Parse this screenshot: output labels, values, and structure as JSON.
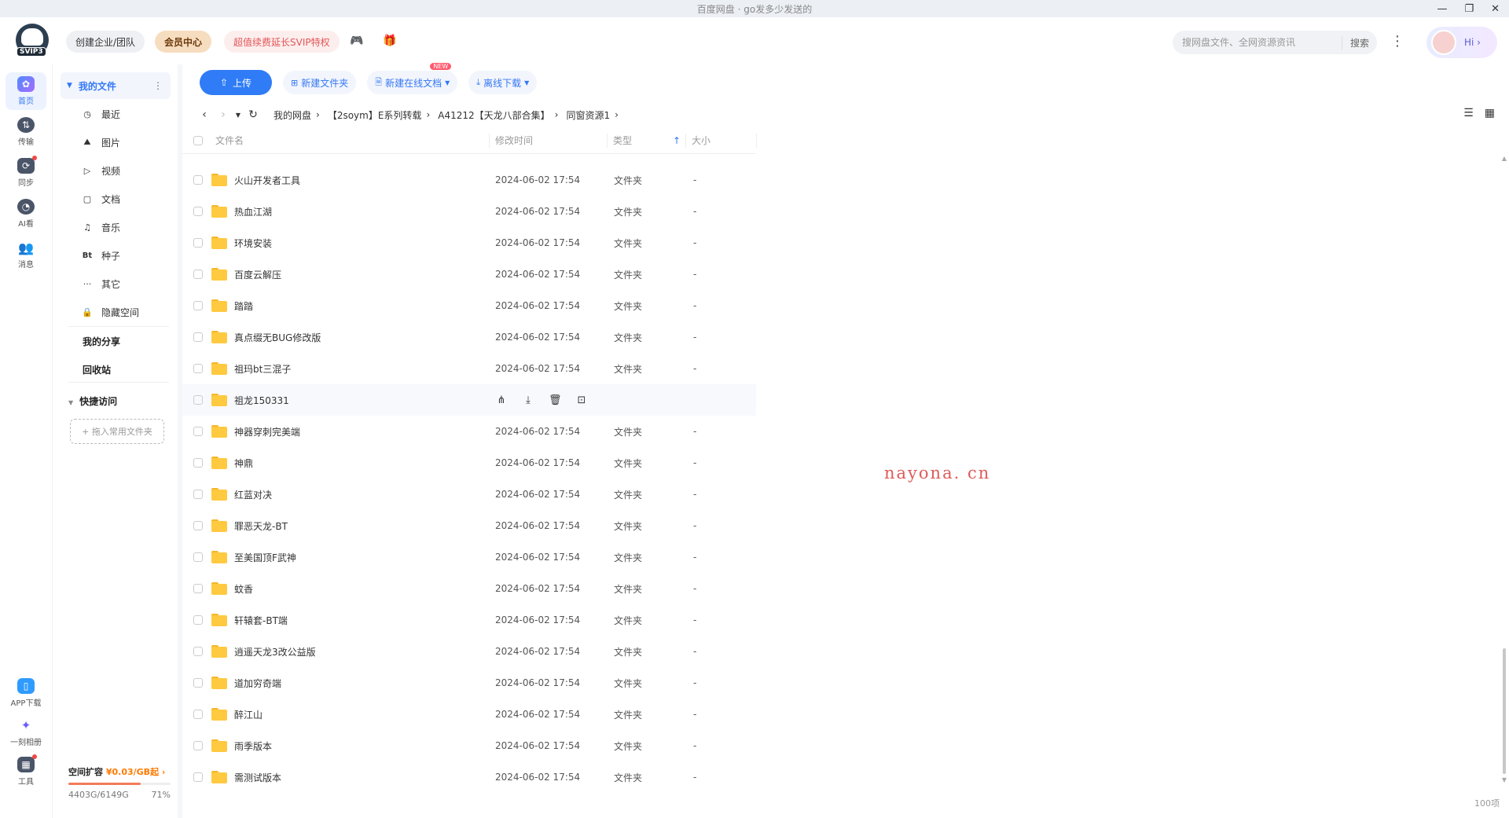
{
  "window": {
    "title": "百度网盘 · go发多少发送的",
    "controls": [
      "—",
      "❐",
      "✕"
    ]
  },
  "header": {
    "logo_badge": "SVIP3",
    "team_label": "创建企业/团队",
    "vip_label": "会员中心",
    "svip_label": "超值续费延长SVIP特权",
    "search_placeholder": "搜网盘文件、全网资源资讯",
    "search_button": "搜索",
    "hi_label": "Hi ›"
  },
  "rail": {
    "items": [
      {
        "label": "首页",
        "icon": "home-icon"
      },
      {
        "label": "传输",
        "icon": "transfer-icon"
      },
      {
        "label": "同步",
        "icon": "sync-icon"
      },
      {
        "label": "AI看",
        "icon": "ai-icon"
      },
      {
        "label": "消息",
        "icon": "message-icon"
      }
    ],
    "bottom": [
      {
        "label": "APP下载",
        "icon": "app-download-icon"
      },
      {
        "label": "一刻相册",
        "icon": "album-icon"
      },
      {
        "label": "工具",
        "icon": "tools-icon"
      }
    ]
  },
  "sidebar": {
    "my_files": "我的文件",
    "items": [
      {
        "label": "最近",
        "icon": "◷"
      },
      {
        "label": "图片",
        "icon": "⛰"
      },
      {
        "label": "视频",
        "icon": "▷"
      },
      {
        "label": "文档",
        "icon": "▢"
      },
      {
        "label": "音乐",
        "icon": "♫"
      },
      {
        "label": "种子",
        "icon": "Bt"
      },
      {
        "label": "其它",
        "icon": "···"
      },
      {
        "label": "隐藏空间",
        "icon": "🔒"
      }
    ],
    "my_share": "我的分享",
    "recycle": "回收站",
    "quick_access": "快捷访问",
    "quick_drop": "+ 拖入常用文件夹",
    "storage": {
      "expand_label": "空间扩容",
      "price": "¥0.03/GB起",
      "used": "4403G/6149G",
      "percent_text": "71%",
      "percent": 71
    }
  },
  "toolbar": {
    "upload": "上传",
    "new_folder": "新建文件夹",
    "new_online_doc": "新建在线文档",
    "new_badge": "NEW",
    "offline_download": "离线下载"
  },
  "breadcrumb": [
    "我的网盘",
    "【2soym】E系列转载",
    "A41212【天龙八部合集】",
    "同窗资源1"
  ],
  "table": {
    "columns": {
      "name": "文件名",
      "time": "修改时间",
      "type": "类型",
      "size": "大小"
    },
    "rows": [
      {
        "name": "火山开发者工具",
        "time": "2024-06-02 17:54",
        "type": "文件夹",
        "size": "-"
      },
      {
        "name": "热血江湖",
        "time": "2024-06-02 17:54",
        "type": "文件夹",
        "size": "-"
      },
      {
        "name": "环境安装",
        "time": "2024-06-02 17:54",
        "type": "文件夹",
        "size": "-"
      },
      {
        "name": "百度云解压",
        "time": "2024-06-02 17:54",
        "type": "文件夹",
        "size": "-"
      },
      {
        "name": "踏踏",
        "time": "2024-06-02 17:54",
        "type": "文件夹",
        "size": "-"
      },
      {
        "name": "真点缀无BUG修改版",
        "time": "2024-06-02 17:54",
        "type": "文件夹",
        "size": "-"
      },
      {
        "name": "祖玛bt三混子",
        "time": "2024-06-02 17:54",
        "type": "文件夹",
        "size": "-"
      },
      {
        "name": "祖龙150331",
        "time": "",
        "type": "",
        "size": "",
        "hover": true
      },
      {
        "name": "神器穿刺完美端",
        "time": "2024-06-02 17:54",
        "type": "文件夹",
        "size": "-"
      },
      {
        "name": "神鼎",
        "time": "2024-06-02 17:54",
        "type": "文件夹",
        "size": "-"
      },
      {
        "name": "红蓝对决",
        "time": "2024-06-02 17:54",
        "type": "文件夹",
        "size": "-"
      },
      {
        "name": "罪恶天龙-BT",
        "time": "2024-06-02 17:54",
        "type": "文件夹",
        "size": "-"
      },
      {
        "name": "至美国顶F武神",
        "time": "2024-06-02 17:54",
        "type": "文件夹",
        "size": "-"
      },
      {
        "name": "蚊香",
        "time": "2024-06-02 17:54",
        "type": "文件夹",
        "size": "-"
      },
      {
        "name": "轩辕套-BT端",
        "time": "2024-06-02 17:54",
        "type": "文件夹",
        "size": "-"
      },
      {
        "name": "逍遥天龙3改公益版",
        "time": "2024-06-02 17:54",
        "type": "文件夹",
        "size": "-"
      },
      {
        "name": "道加穷奇端",
        "time": "2024-06-02 17:54",
        "type": "文件夹",
        "size": "-"
      },
      {
        "name": "醉江山",
        "time": "2024-06-02 17:54",
        "type": "文件夹",
        "size": "-"
      },
      {
        "name": "雨季版本",
        "time": "2024-06-02 17:54",
        "type": "文件夹",
        "size": "-"
      },
      {
        "name": "需测试版本",
        "time": "2024-06-02 17:54",
        "type": "文件夹",
        "size": "-"
      }
    ]
  },
  "watermark": "nayona. cn",
  "item_count": "100项"
}
